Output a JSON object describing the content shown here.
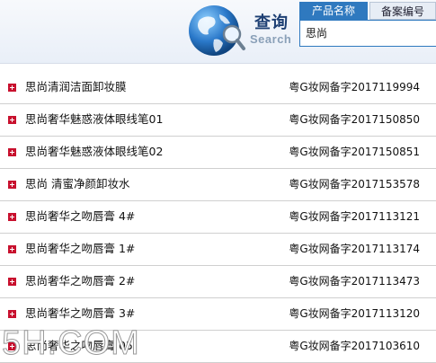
{
  "header": {
    "search_cn": "查询",
    "search_en": "Search",
    "tabs": [
      {
        "label": "产品名称",
        "active": true
      },
      {
        "label": "备案编号",
        "active": false
      }
    ],
    "search_value": "思尚"
  },
  "results": [
    {
      "name": "思尚清润洁面卸妆膜",
      "reg_no": "粤G妆网备字2017119994"
    },
    {
      "name": "思尚奢华魅惑液体眼线笔01",
      "reg_no": "粤G妆网备字2017150850"
    },
    {
      "name": "思尚奢华魅惑液体眼线笔02",
      "reg_no": "粤G妆网备字2017150851"
    },
    {
      "name": "思尚 清蜜净颜卸妆水",
      "reg_no": "粤G妆网备字2017153578"
    },
    {
      "name": "思尚奢华之吻唇膏 4#",
      "reg_no": "粤G妆网备字2017113121"
    },
    {
      "name": "思尚奢华之吻唇膏 1#",
      "reg_no": "粤G妆网备字2017113174"
    },
    {
      "name": "思尚奢华之吻唇膏 2#",
      "reg_no": "粤G妆网备字2017113473"
    },
    {
      "name": "思尚奢华之吻唇膏 3#",
      "reg_no": "粤G妆网备字2017113120"
    },
    {
      "name": "思尚奢华之吻唇膏 05",
      "reg_no": "粤G妆网备字2017103610"
    }
  ],
  "watermark": "5H.COM",
  "colors": {
    "accent": "#2f79bf",
    "bullet": "#c8102e"
  }
}
